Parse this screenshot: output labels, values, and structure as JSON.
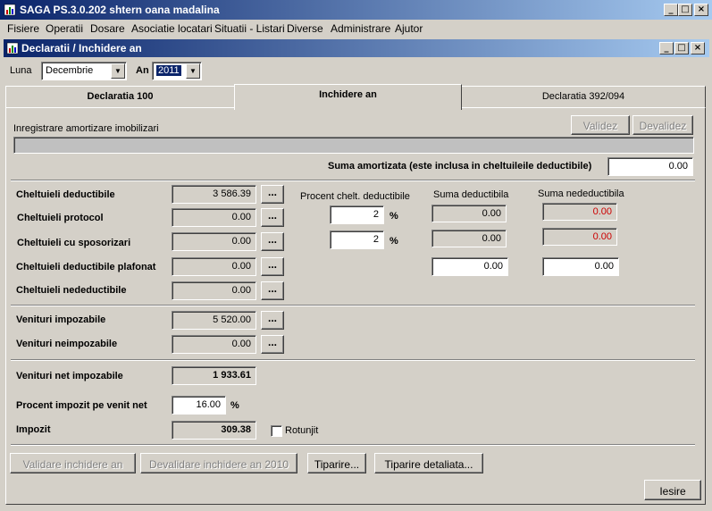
{
  "window": {
    "title": "SAGA PS.3.0.202    shtern oana madalina"
  },
  "menu": [
    "Fisiere",
    "Operatii",
    "Dosare",
    "Asociatie locatari",
    "Situatii - Listari",
    "Diverse",
    "Administrare",
    "Ajutor"
  ],
  "child_window": {
    "title": "Declaratii / Inchidere an"
  },
  "filters": {
    "luna_label": "Luna",
    "luna_value": "Decembrie",
    "an_label": "An",
    "an_value": "2011"
  },
  "tabs": [
    "Declaratia 100",
    "Inchidere an",
    "Declaratia 392/094"
  ],
  "amortizare": {
    "label": "Inregistrare amortizare imobilizari",
    "validez": "Validez",
    "devalidez": "Devalidez",
    "suma_label": "Suma amortizata (este inclusa in cheltuileile deductibile)",
    "suma_value": "0.00"
  },
  "headers": {
    "procent": "Procent chelt. deductibile",
    "suma_deductibila": "Suma deductibila",
    "suma_nedeductibila": "Suma nedeductibila"
  },
  "cheltuieli": {
    "deductibile_label": "Cheltuieli deductibile",
    "deductibile_value": "3 586.39",
    "protocol_label": "Cheltuieli protocol",
    "protocol_value": "0.00",
    "protocol_pct": "2",
    "protocol_ded": "0.00",
    "protocol_neded": "0.00",
    "sponsorizari_label": "Cheltuieli cu sposorizari",
    "sponsorizari_value": "0.00",
    "sponsorizari_pct": "2",
    "sponsorizari_ded": "0.00",
    "sponsorizari_neded": "0.00",
    "plafonat_label": "Cheltuieli deductibile plafonat",
    "plafonat_value": "0.00",
    "plafonat_ded": "0.00",
    "plafonat_neded": "0.00",
    "nedeductibile_label": "Cheltuieli nedeductibile",
    "nedeductibile_value": "0.00"
  },
  "venituri": {
    "impozabile_label": "Venituri impozabile",
    "impozabile_value": "5 520.00",
    "neimpozabile_label": "Venituri neimpozabile",
    "neimpozabile_value": "0.00",
    "net_label": "Venituri net impozabile",
    "net_value": "1 933.61"
  },
  "impozit": {
    "procent_label": "Procent impozit pe venit net",
    "procent_value": "16.00",
    "label": "Impozit",
    "value": "309.38",
    "rotunjit": "Rotunjit"
  },
  "percent_sign": "%",
  "dots": "...",
  "buttons": {
    "validare": "Validare inchidere an",
    "devalidare": "Devalidare inchidere an 2010",
    "tiparire": "Tiparire...",
    "tiparire_detaliata": "Tiparire detaliata...",
    "iesire": "Iesire"
  }
}
